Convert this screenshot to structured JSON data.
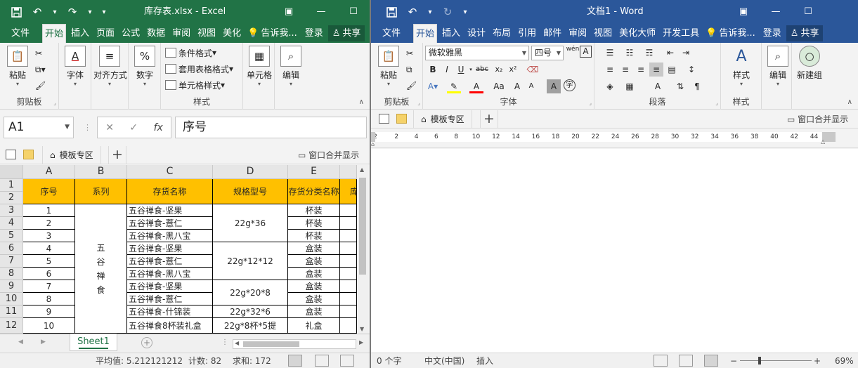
{
  "excel": {
    "title": "库存表.xlsx - Excel",
    "qat": {
      "save_icon": "save-icon",
      "undo": "↶",
      "redo": "↷",
      "customize": "▾"
    },
    "window_controls": {
      "ribbon_display": "▣",
      "minimize": "—",
      "maximize": "☐"
    },
    "tabs": [
      "文件",
      "开始",
      "插入",
      "页面",
      "公式",
      "数据",
      "审阅",
      "视图",
      "美化"
    ],
    "active_tab": "开始",
    "tell_me": "告诉我...",
    "login": "登录",
    "share": "共享",
    "ribbon": {
      "paste": "粘贴",
      "clipboard_group": "剪贴板",
      "font": "字体",
      "alignment": "对齐方式",
      "number": "数字",
      "conditional_format": "条件格式",
      "format_as_table": "套用表格格式",
      "cell_styles": "单元格样式",
      "styles_group": "样式",
      "cells": "单元格",
      "editing": "编辑",
      "number_icon": "%"
    },
    "formula_bar": {
      "name_box": "A1",
      "cancel": "✕",
      "enter": "✓",
      "fx": "fx",
      "value": "序号"
    },
    "doc_tabs": {
      "template_tab": "模板专区",
      "add": "+",
      "merge_display": "窗口合并显示"
    },
    "columns": [
      "A",
      "B",
      "C",
      "D",
      "E"
    ],
    "rows": [
      "1",
      "2",
      "3",
      "4",
      "5",
      "6",
      "7",
      "8",
      "9",
      "10",
      "11",
      "12"
    ],
    "header_row": {
      "seq": "序号",
      "series": "系列",
      "name": "存货名称",
      "spec": "规格型号",
      "category": "存货分类名称",
      "partial": "库"
    },
    "series_merged": "五\n谷\n禅\n食",
    "data_rows": [
      {
        "seq": "1",
        "name": "五谷禅食-坚果",
        "category": "杯装"
      },
      {
        "seq": "2",
        "name": "五谷禅食-薏仁",
        "category": "杯装"
      },
      {
        "seq": "3",
        "name": "五谷禅食-黑八宝",
        "category": "杯装"
      },
      {
        "seq": "4",
        "name": "五谷禅食-坚果",
        "category": "盒装"
      },
      {
        "seq": "5",
        "name": "五谷禅食-薏仁",
        "category": "盒装"
      },
      {
        "seq": "6",
        "name": "五谷禅食-黑八宝",
        "category": "盒装"
      },
      {
        "seq": "7",
        "name": "五谷禅食-坚果",
        "category": "盒装"
      },
      {
        "seq": "8",
        "name": "五谷禅食-薏仁",
        "category": "盒装"
      },
      {
        "seq": "9",
        "name": "五谷禅食-什锦装",
        "category": "盒装"
      },
      {
        "seq": "10",
        "name": "五谷禅食8杯装礼盒",
        "category": "礼盒"
      }
    ],
    "spec_merged": [
      "22g*36",
      "22g*12*12",
      "22g*20*8",
      "22g*32*6",
      "22g*8杯*5提"
    ],
    "sheet_tab": "Sheet1",
    "status": {
      "average": "平均值: 5.212121212",
      "count": "计数: 82",
      "sum": "求和: 172"
    }
  },
  "word": {
    "title": "文档1 - Word",
    "qat": {
      "undo": "↶",
      "redo": "↻",
      "customize": "▾"
    },
    "window_controls": {
      "ribbon_display": "▣",
      "minimize": "—",
      "maximize": "☐"
    },
    "tabs": [
      "文件",
      "开始",
      "插入",
      "设计",
      "布局",
      "引用",
      "邮件",
      "审阅",
      "视图",
      "美化大师",
      "开发工具"
    ],
    "active_tab": "开始",
    "tell_me": "告诉我...",
    "login": "登录",
    "share": "共享",
    "ribbon": {
      "paste": "粘贴",
      "clipboard_group": "剪贴板",
      "font_name": "微软雅黑",
      "font_size": "四号",
      "font_group": "字体",
      "paragraph_group": "段落",
      "styles": "样式",
      "styles_group": "样式",
      "editing": "编辑",
      "new_group": "新建组",
      "bold": "B",
      "italic": "I",
      "underline": "U",
      "strike": "abc",
      "sub": "x₂",
      "sup": "x²",
      "grow": "A",
      "shrink": "A",
      "aa": "Aa",
      "phonetic": "wén",
      "char_border": "A",
      "char_shade": "A",
      "enclosed": "字"
    },
    "doc_tabs": {
      "template_tab": "模板专区",
      "add": "+",
      "merge_display": "窗口合并显示"
    },
    "ruler": [
      "2",
      "2",
      "4",
      "6",
      "8",
      "10",
      "12",
      "14",
      "16",
      "18",
      "20",
      "22",
      "24",
      "26",
      "28",
      "30",
      "32",
      "34",
      "36",
      "38",
      "40",
      "42",
      "44"
    ],
    "status": {
      "words": "0 个字",
      "language": "中文(中国)",
      "mode": "插入",
      "zoom": "69%",
      "minus": "−",
      "plus": "+"
    }
  }
}
